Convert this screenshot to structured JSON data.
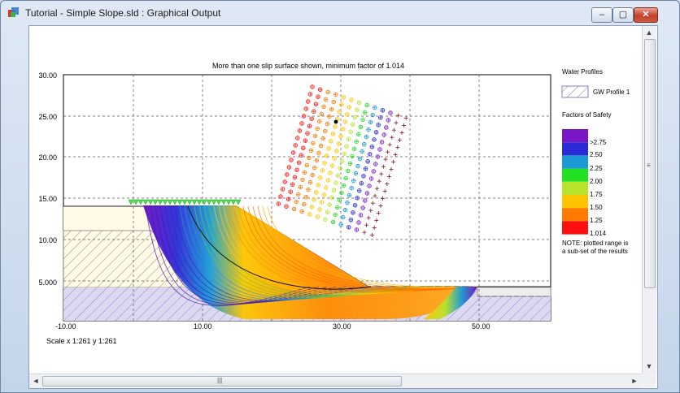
{
  "window": {
    "title": "Tutorial - Simple Slope.sld : Graphical Output",
    "min_label": "–",
    "max_label": "▢",
    "close_label": "✕"
  },
  "plot": {
    "caption": "More than one slip surface shown, minimum factor of 1.014",
    "scale_text": "Scale x 1:261  y 1:261",
    "x_ticks": [
      "-10.00",
      "10.00",
      "30.00",
      "50.00"
    ],
    "y_ticks": [
      "30.00",
      "25.00",
      "20.00",
      "15.00",
      "10.00",
      "5.000"
    ]
  },
  "legend": {
    "water_title": "Water Profiles",
    "gw_label": "GW Profile 1",
    "fos_title": "Factors of Safety",
    "fos_labels": [
      ">2.75",
      "2.50",
      "2.25",
      "2.00",
      "1.75",
      "1.50",
      "1.25",
      "1.014"
    ],
    "fos_colors": [
      "#7a16c8",
      "#2a2ad6",
      "#1b9ad6",
      "#22e022",
      "#b8e32a",
      "#ffc400",
      "#ff7a00",
      "#ff1010"
    ],
    "note_line1": "NOTE: plotted range is",
    "note_line2": "a sub-set of the results"
  },
  "scroll": {
    "up": "▲",
    "down": "▼",
    "left": "◄",
    "right": "►",
    "grip_v": "≡",
    "grip_h": "|||"
  }
}
